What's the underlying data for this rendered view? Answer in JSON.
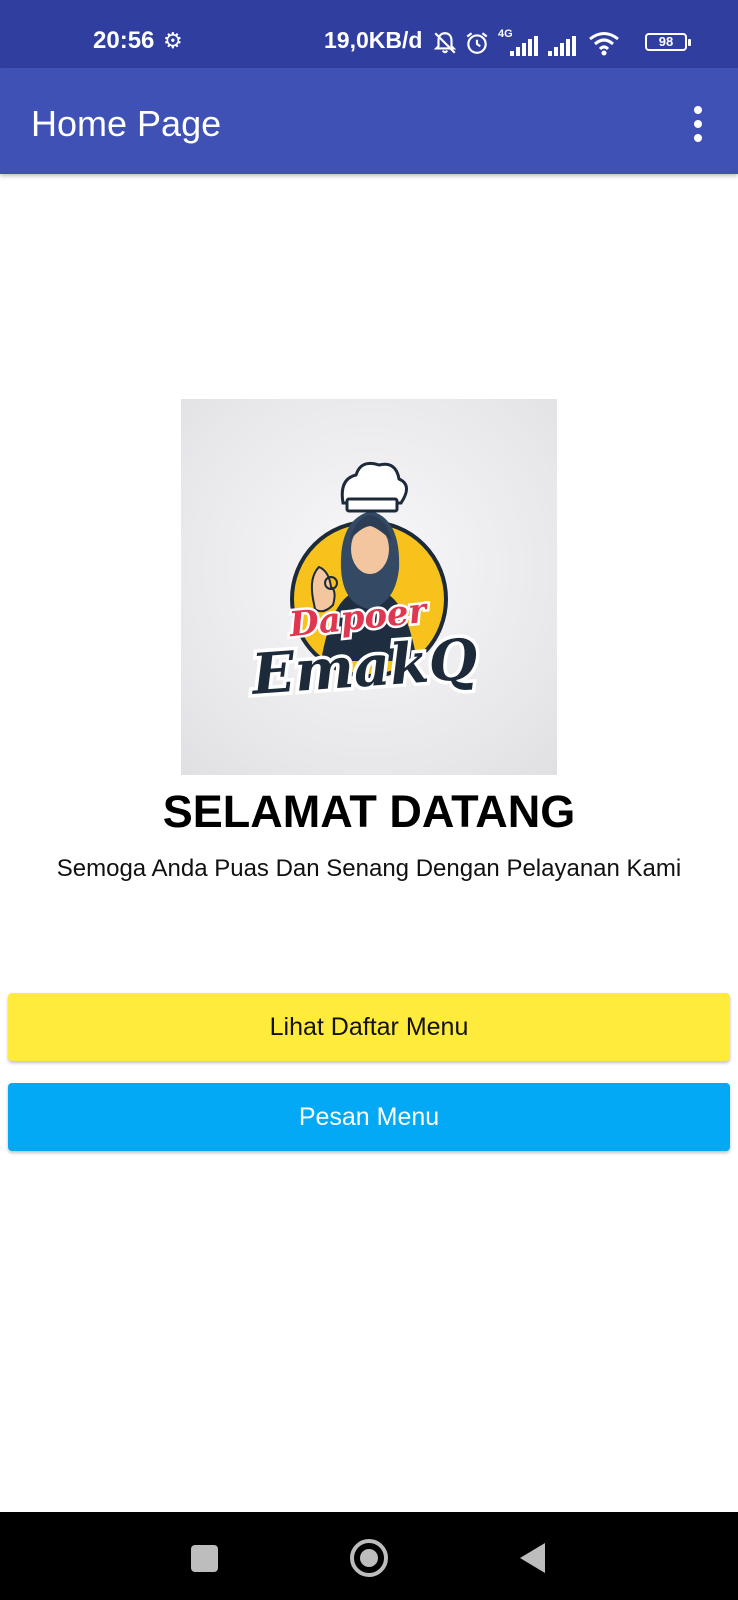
{
  "status_bar": {
    "time": "20:56",
    "settings_icon": "gear-icon",
    "net_speed": "19,0KB/d",
    "icons": [
      "bell-off-icon",
      "alarm-icon",
      "4g-signal-icon",
      "signal-icon",
      "wifi-icon"
    ],
    "network_type": "4G",
    "battery": "98"
  },
  "app_bar": {
    "title": "Home Page",
    "overflow_icon": "more-vert-icon",
    "color": "#3f51b5"
  },
  "logo": {
    "line1": "Dapoer",
    "line2": "EmakQ"
  },
  "main": {
    "title": "SELAMAT DATANG",
    "subtitle": "Semoga Anda Puas Dan Senang Dengan Pelayanan Kami"
  },
  "buttons": {
    "menu_list": {
      "label": "Lihat Daftar Menu",
      "color": "#ffeb3b"
    },
    "order": {
      "label": "Pesan Menu",
      "color": "#03a9f4"
    }
  },
  "nav_bar": {
    "icons": [
      "recents-icon",
      "home-icon",
      "back-icon"
    ]
  }
}
